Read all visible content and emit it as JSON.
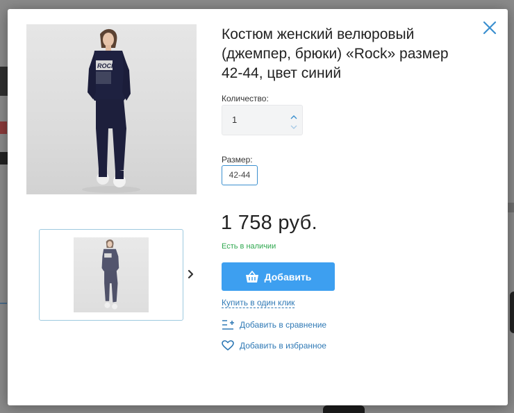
{
  "product": {
    "title": "Костюм женский велюровый (джемпер, брюки) «Rock» размер 42-44, цвет синий",
    "quantity_label": "Количество:",
    "quantity_value": "1",
    "size_label": "Размер:",
    "sizes": [
      "42-44"
    ],
    "selected_size": "42-44",
    "price": "1 758 руб.",
    "stock_status": "Есть в наличии",
    "print_text": "ROCK"
  },
  "actions": {
    "add_to_cart": "Добавить",
    "buy_one_click": "Купить в один клик",
    "add_compare": "Добавить в сравнение",
    "add_favorite": "Добавить в избранное"
  },
  "icons": {
    "close": "close-icon",
    "next": "chevron-right-icon",
    "cart": "basket-icon",
    "compare": "compare-list-icon",
    "favorite": "heart-icon",
    "qty_up": "chevron-up-icon",
    "qty_down": "chevron-down-icon"
  },
  "colors": {
    "accent": "#3d9ff0",
    "link": "#2f79b5",
    "stock": "#2fa84f",
    "close": "#3a8fcf",
    "thumb_border": "#9dc9df"
  }
}
